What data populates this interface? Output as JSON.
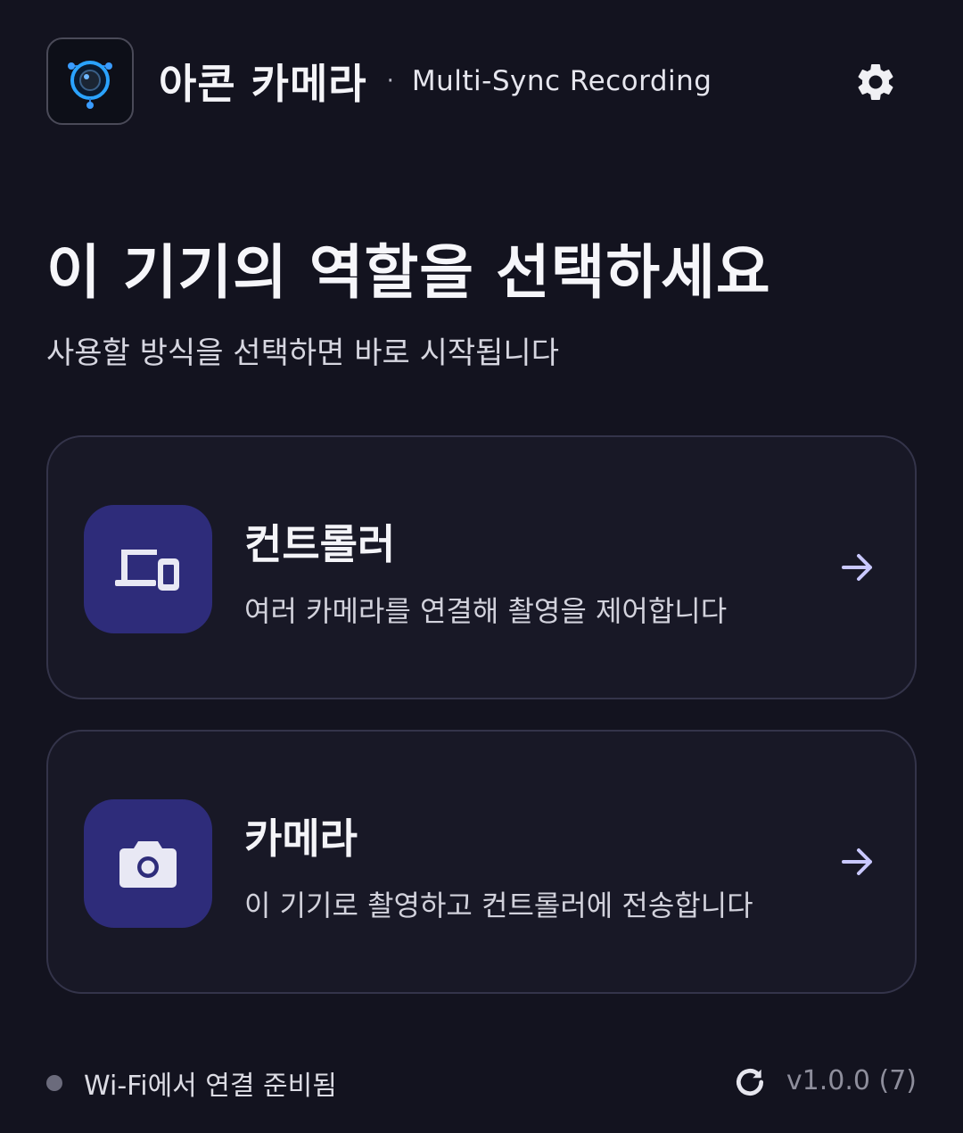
{
  "header": {
    "app_name": "아콘 카메라",
    "separator": "·",
    "subtitle": "Multi-Sync Recording",
    "logo_icon": "camera-lens-logo-icon",
    "settings_icon": "gear-icon"
  },
  "main": {
    "headline": "이 기기의 역할을 선택하세요",
    "subheadline": "사용할 방식을 선택하면 바로 시작됩니다",
    "roles": [
      {
        "title": "컨트롤러",
        "description": "여러 카메라를 연결해 촬영을 제어합니다",
        "icon": "devices-icon"
      },
      {
        "title": "카메라",
        "description": "이 기기로 촬영하고 컨트롤러에 전송합니다",
        "icon": "camera-icon"
      }
    ]
  },
  "footer": {
    "status_text": "Wi-Fi에서 연결 준비됨",
    "refresh_icon": "refresh-icon",
    "version": "v1.0.0 (7)"
  },
  "colors": {
    "background": "#13131f",
    "card_background": "#181826",
    "card_border": "#34344a",
    "icon_tile": "#2e2c7a",
    "accent": "#c9c8ff",
    "status_dot": "#6b6b7c"
  }
}
